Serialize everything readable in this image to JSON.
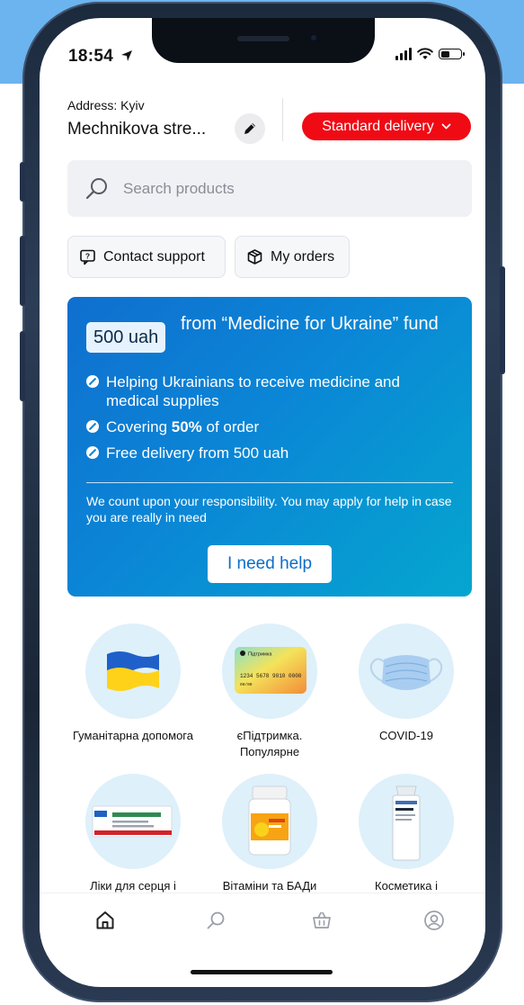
{
  "status_bar": {
    "time": "18:54"
  },
  "header": {
    "address_label": "Address: Kyiv",
    "address_value": "Mechnikova stre...",
    "delivery_label": "Standard delivery"
  },
  "search": {
    "placeholder": "Search products"
  },
  "quick_actions": {
    "contact_support": "Contact support",
    "my_orders": "My orders"
  },
  "promo": {
    "amount": "500 uah",
    "heading": "from “Medicine for Ukraine” fund",
    "bullets": {
      "b1": "Helping Ukrainians to receive medicine and medical supplies",
      "b2_prefix": "Covering ",
      "b2_bold": "50%",
      "b2_suffix": " of order",
      "b3": "Free delivery from 500 uah"
    },
    "note": "We count upon your responsibility. You may apply for help in case you are really in need",
    "button_label": "I need help"
  },
  "categories": {
    "c1": "Гуманітарна допомога",
    "c2": "єПідтримка. Популярне",
    "c3": "COVID-19",
    "c4": "Ліки для серця і",
    "c5": "Вітаміни та БАДи",
    "c6": "Косметика і"
  },
  "card_art": {
    "brand": "Підтримка",
    "number": "1234 5678 9010 0000",
    "expiry": "00/00"
  },
  "tabbar_icons": [
    "home-icon",
    "search-icon",
    "basket-icon",
    "profile-icon"
  ],
  "colors": {
    "accent_red": "#f00a14",
    "promo_blue": "#0b86d6",
    "button_text_blue": "#0d6ec8",
    "category_circle": "#def0fa"
  }
}
